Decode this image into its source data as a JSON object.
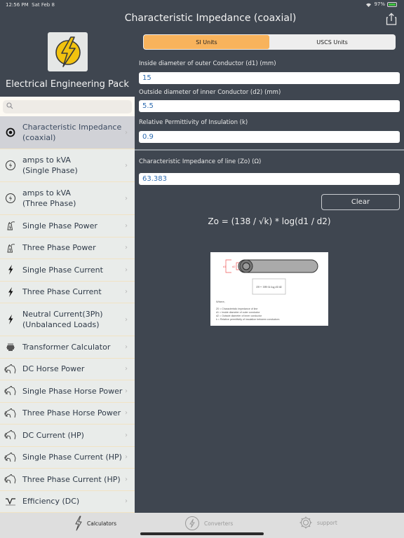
{
  "status_bar": {
    "time": "12:56 PM",
    "date": "Sat Feb 8",
    "battery": "97%"
  },
  "nav": {
    "title": "Characteristic Impedance (coaxial)"
  },
  "sidebar": {
    "app_name": "Electrical Engineering Pack",
    "search_placeholder": "",
    "items": [
      {
        "label": "Characteristic Impedance (coaxial)",
        "icon": "target-icon",
        "selected": true
      },
      {
        "label": "amps to kVA (Single Phase)",
        "icon": "bolt-circle-icon"
      },
      {
        "label": "amps to kVA (Three Phase)",
        "icon": "bolt-circle-icon"
      },
      {
        "label": "Single Phase Power",
        "icon": "power-plant-icon"
      },
      {
        "label": "Three Phase Power",
        "icon": "power-plant-icon"
      },
      {
        "label": "Single Phase Current",
        "icon": "bolt-icon"
      },
      {
        "label": "Three Phase Current",
        "icon": "bolt-icon"
      },
      {
        "label": "Neutral Current(3Ph) (Unbalanced Loads)",
        "icon": "bolt-icon"
      },
      {
        "label": "Transformer Calculator",
        "icon": "transformer-icon"
      },
      {
        "label": "DC Horse Power",
        "icon": "horse-icon"
      },
      {
        "label": "Single Phase Horse Power",
        "icon": "horse-icon"
      },
      {
        "label": "Three Phase Horse Power",
        "icon": "horse-icon"
      },
      {
        "label": "DC Current (HP)",
        "icon": "horse-icon"
      },
      {
        "label": "Single Phase Current (HP)",
        "icon": "horse-icon"
      },
      {
        "label": "Three Phase Current (HP)",
        "icon": "horse-icon"
      },
      {
        "label": "Efficiency (DC)",
        "icon": "waveform-icon"
      }
    ]
  },
  "main": {
    "units": {
      "options": [
        "SI Units",
        "USCS Units"
      ],
      "selected": "SI Units"
    },
    "fields": [
      {
        "label": "Inside diameter of outer Conductor (d1) (mm)",
        "value": "15"
      },
      {
        "label": "Outside diameter of inner Conductor (d2) (mm)",
        "value": "5.5"
      },
      {
        "label": "Relative Permittivity of Insulation (k)",
        "value": "0.9"
      }
    ],
    "result": {
      "label": "Characteristic Impedance of line (Zo) (Ω)",
      "value": "63.383"
    },
    "clear_label": "Clear",
    "formula": "Zo = (138 / √k) * log(d1 / d2)",
    "diagram": {
      "d1_label": "d1",
      "d2_label": "d2",
      "formula_text": "Z0 = 138/√k log d1/d2",
      "where_label": "Where,",
      "legend": [
        "Z0 = Characteristic impedance of line",
        "d1 = Inside diameter of outer conductor",
        "d2 = Outside diameter of inner conductor",
        "k = Relative permittivity of insulation between conductors"
      ]
    }
  },
  "tab_bar": {
    "tabs": [
      {
        "label": "Calculators",
        "icon": "bolt-icon",
        "active": true
      },
      {
        "label": "Converters",
        "icon": "bolt-circle-icon",
        "active": false
      },
      {
        "label": "support",
        "icon": "gear-icon",
        "active": false
      }
    ]
  }
}
